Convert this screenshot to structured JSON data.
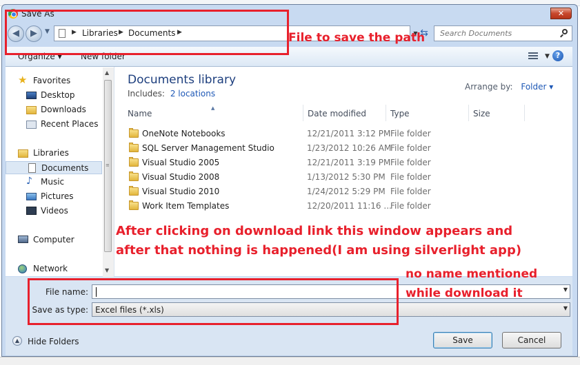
{
  "window": {
    "title": "Save As",
    "close_glyph": "✕"
  },
  "address": {
    "crumbs": [
      "Libraries",
      "Documents"
    ],
    "search_placeholder": "Search Documents"
  },
  "toolbar": {
    "organize": "Organize ▾",
    "new_folder": "New folder"
  },
  "sidebar": {
    "favorites": "Favorites",
    "desktop": "Desktop",
    "downloads": "Downloads",
    "recent_places": "Recent Places",
    "libraries": "Libraries",
    "documents": "Documents",
    "music": "Music",
    "pictures": "Pictures",
    "videos": "Videos",
    "computer": "Computer",
    "network": "Network"
  },
  "library": {
    "title": "Documents library",
    "includes_label": "Includes:",
    "includes_link": "2 locations",
    "arrange_label": "Arrange by:",
    "arrange_value": "Folder ▾"
  },
  "columns": {
    "name": "Name",
    "date_modified": "Date modified",
    "type": "Type",
    "size": "Size"
  },
  "files": [
    {
      "name": "OneNote Notebooks",
      "date": "12/21/2011 3:12 PM",
      "type": "File folder"
    },
    {
      "name": "SQL Server Management Studio",
      "date": "1/23/2012 10:26 AM",
      "type": "File folder"
    },
    {
      "name": "Visual Studio 2005",
      "date": "12/21/2011 3:19 PM",
      "type": "File folder"
    },
    {
      "name": "Visual Studio 2008",
      "date": "1/13/2012 5:30 PM",
      "type": "File folder"
    },
    {
      "name": "Visual Studio 2010",
      "date": "1/24/2012 5:29 PM",
      "type": "File folder"
    },
    {
      "name": "Work Item Templates",
      "date": "12/20/2011 11:16 ...",
      "type": "File folder"
    }
  ],
  "form": {
    "file_name_label": "File name:",
    "file_name_value": "",
    "save_type_label": "Save as type:",
    "save_type_value": "Excel files (*.xls)"
  },
  "footer": {
    "hide_folders": "Hide Folders",
    "save": "Save",
    "cancel": "Cancel"
  },
  "annotations": {
    "path_note": "File to save the path",
    "main_note_1": "After clicking on download link this window appears and",
    "main_note_2": "after that nothing is happened(I am using silverlight app)",
    "name_note_1": "no name mentioned",
    "name_note_2": "while download it"
  },
  "colors": {
    "annotation_red": "#e8202c",
    "library_title": "#1e3f7e",
    "link_blue": "#1e58b6"
  }
}
